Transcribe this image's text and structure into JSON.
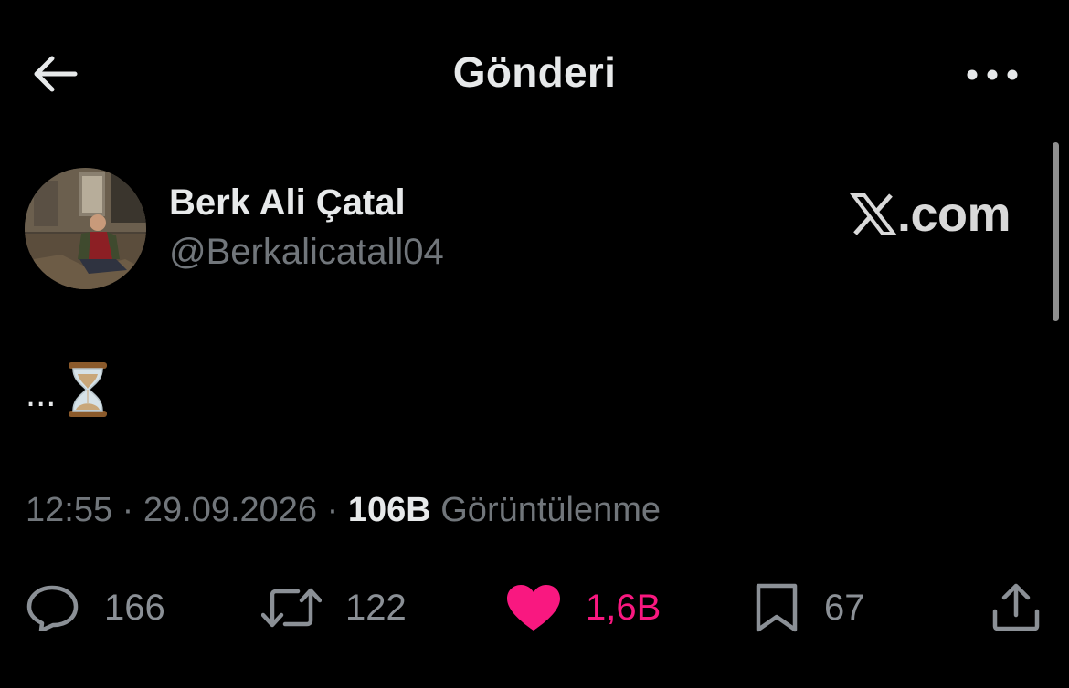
{
  "header": {
    "title": "Gönderi",
    "back_icon": "arrow-left-icon",
    "more_icon": "more-horizontal-icon"
  },
  "author": {
    "name": "Berk Ali Çatal",
    "handle": "@Berkalicatall04"
  },
  "watermark": {
    "text": ".com",
    "logo": "x-logo-icon"
  },
  "post": {
    "text": "...",
    "emoji": "hourglass-icon"
  },
  "meta": {
    "time": "12:55",
    "separator": "·",
    "date": "29.09.2026",
    "views_count": "106B",
    "views_label": "Görüntülenme"
  },
  "actions": {
    "replies": "166",
    "reposts": "122",
    "likes": "1,6B",
    "bookmarks": "67"
  },
  "colors": {
    "background": "#000000",
    "primary_text": "#e7e9ea",
    "secondary_text": "#71767b",
    "like_accent": "#f91880"
  }
}
